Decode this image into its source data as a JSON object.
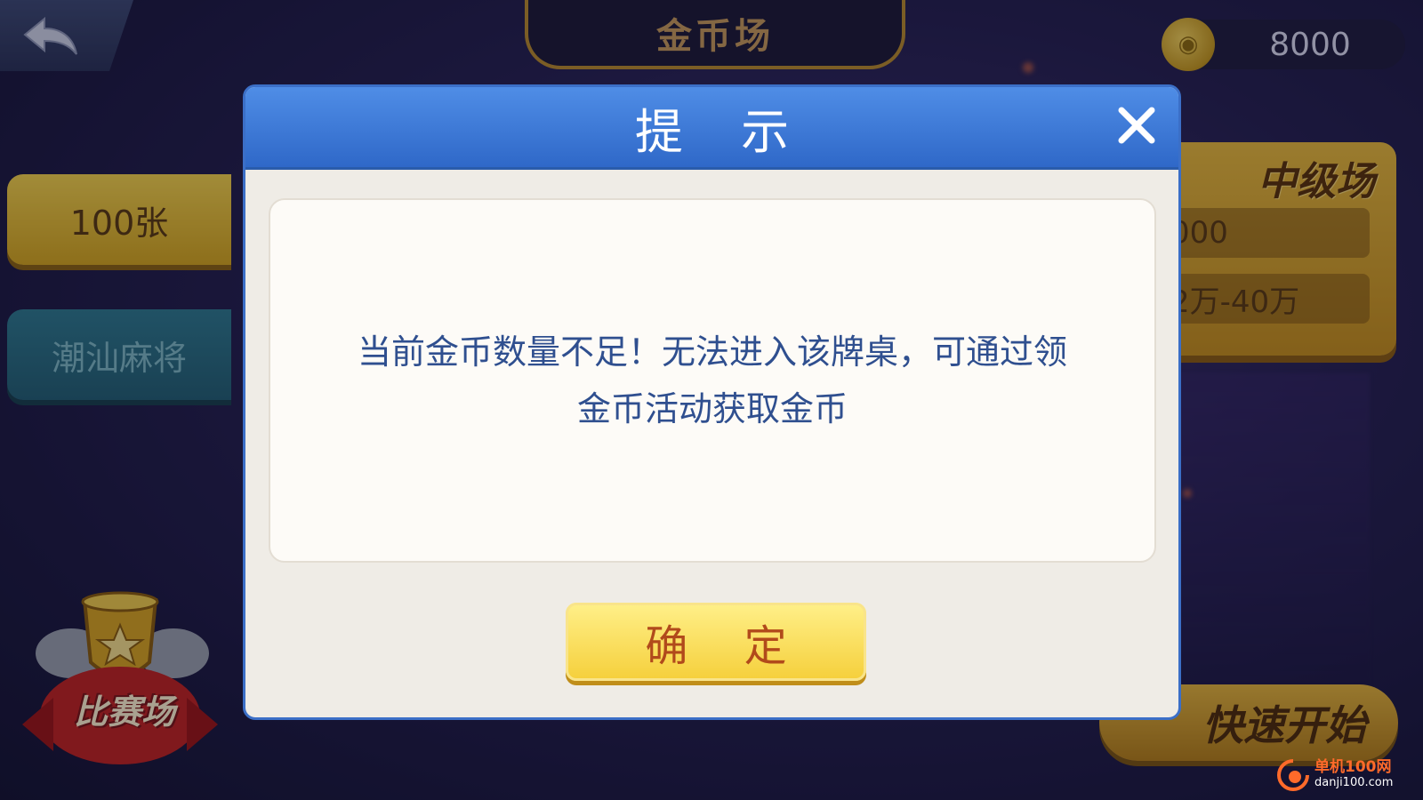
{
  "topbar": {
    "title": "金币场",
    "coins": "8000"
  },
  "left_menu": {
    "items": [
      {
        "label": "100张",
        "active": true
      },
      {
        "label": "潮汕麻将",
        "active": false
      }
    ],
    "contest_label": "比赛场"
  },
  "room_card": {
    "title": "中级场",
    "row1": "000",
    "row2": "2万-40万"
  },
  "quick_start_label": "快速开始",
  "dialog": {
    "title": "提 示",
    "message_line1": "当前金币数量不足！无法进入该牌桌，可通过领",
    "message_line2": "金币活动获取金币",
    "confirm_label": "确 定"
  },
  "watermark": {
    "cn": "单机100网",
    "url": "danji100.com"
  },
  "colors": {
    "dialog_header": "#2f68c8",
    "confirm_button": "#f5cf3a",
    "message_text": "#2f4f8f"
  }
}
